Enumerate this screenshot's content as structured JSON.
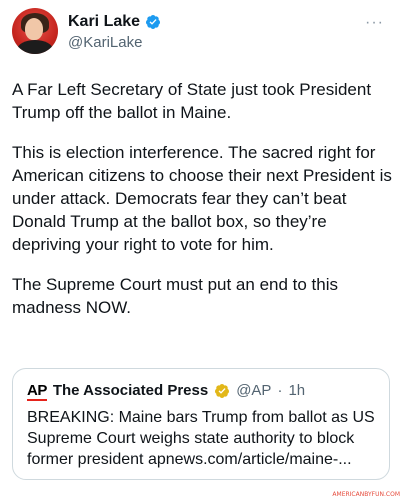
{
  "author": {
    "display_name": "Kari Lake",
    "handle": "@KariLake",
    "avatar_icon": "profile-photo",
    "verified_icon": "blue-check-icon",
    "more_icon": "···"
  },
  "tweet": {
    "paragraphs": [
      "A Far Left Secretary of State just took President Trump off the ballot in Maine.",
      "This is election interference. The sacred right for American citizens to choose their next President is under attack. Democrats fear they can’t beat Donald Trump at the ballot box, so they’re depriving your right to vote for him.",
      "The Supreme Court must put an end to this madness NOW."
    ]
  },
  "quote": {
    "logo_text": "AP",
    "name": "The Associated Press",
    "handle": "@AP",
    "separator": "·",
    "time": "1h",
    "badge_icon": "gold-check-icon",
    "text": "BREAKING: Maine bars Trump from ballot as US Supreme Court weighs state authority to block former president apnews.com/article/maine-..."
  },
  "colors": {
    "verified_blue": "#1d9bf0",
    "gold_badge": "#e2b719",
    "ap_red": "#e5231b"
  },
  "watermark": "AMERICANBYFUN.COM"
}
